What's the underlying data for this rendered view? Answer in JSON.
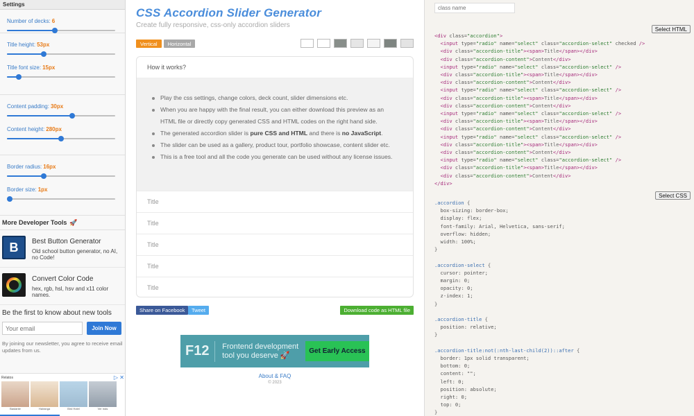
{
  "sidebar": {
    "header": "Settings",
    "controls": [
      {
        "label": "Number of decks:",
        "value": "6",
        "pct": 0.44
      },
      {
        "label": "Title height:",
        "value": "53px",
        "pct": 0.34
      },
      {
        "label": "Title font size:",
        "value": "15px",
        "pct": 0.11
      },
      {
        "label": "Content padding:",
        "value": "30px",
        "pct": 0.6
      },
      {
        "label": "Content height:",
        "value": "280px",
        "pct": 0.5
      },
      {
        "label": "Border radius:",
        "value": "16px",
        "pct": 0.34
      },
      {
        "label": "Border size:",
        "value": "1px",
        "pct": 0.0
      }
    ],
    "more_tools_title": "More Developer Tools",
    "tools": [
      {
        "name": "Best Button Generator",
        "desc": "Old school button generator, no AI, no Code!",
        "logo": "B"
      },
      {
        "name": "Convert Color Code",
        "desc": "hex, rgb, hsl, hsv and x11 color names.",
        "logo": "C"
      }
    ],
    "newsletter": {
      "title": "Be the first to know about new tools",
      "placeholder": "Your email",
      "button": "Join Now",
      "note": "By joining our newsletter, you agree to receive email updates from us."
    },
    "ad": {
      "label": "Relatos",
      "captions": [
        "Bastante",
        "Hairanga",
        "Bird Hotel",
        "Ver más"
      ]
    }
  },
  "main": {
    "title": "CSS Accordion Slider Generator",
    "subtitle": "Create fully responsive, css-only accordion sliders",
    "orientation": {
      "vertical": "Vertical",
      "horizontal": "Horizontal"
    },
    "swatches": [
      "#ffffff",
      "#ffffff",
      "#888e8a",
      "#e6e6e6",
      "#f4f4f4",
      "#7e8581",
      "#e4e4e4"
    ],
    "accordion": {
      "open_title": "How it works?",
      "bullets": [
        {
          "pre": "Play the css settings, change colors, deck count, slider dimensions etc.",
          "bold": "",
          "post": "",
          "bold2": "",
          "post2": ""
        },
        {
          "pre": "When you are happy with the final result, you can either download this preview as an HTML file or directly copy generated CSS and HTML codes on the right hand side.",
          "bold": "",
          "post": "",
          "bold2": "",
          "post2": ""
        },
        {
          "pre": "The generated accordion slider is ",
          "bold": "pure CSS and HTML",
          "post": " and there is ",
          "bold2": "no JavaScript",
          "post2": "."
        },
        {
          "pre": "The slider can be used as a gallery, product tour, portfolio showcase, content slider etc.",
          "bold": "",
          "post": "",
          "bold2": "",
          "post2": ""
        },
        {
          "pre": "This is a free tool and all the code you generate can be used without any license issues.",
          "bold": "",
          "post": "",
          "bold2": "",
          "post2": ""
        }
      ],
      "titles": [
        "Title",
        "Title",
        "Title",
        "Title",
        "Title"
      ]
    },
    "share_facebook": "Share on Facebook",
    "tweet": "Tweet",
    "download": "Download code as HTML file",
    "banner": {
      "logo": "F12",
      "text": "Frontend development tool you deserve 🚀",
      "button": "Get Early Access"
    },
    "footer_link": "About & FAQ",
    "footer_copy": "© 2023"
  },
  "code_panel": {
    "class_placeholder": "class name",
    "select_html": "Select HTML",
    "select_css": "Select CSS"
  },
  "colors": {
    "accent": "#2f79d6",
    "orange": "#e77b18",
    "title": "#4a8ddb",
    "facebook": "#3b5998",
    "tweet": "#55acee",
    "download": "#4caf32",
    "vertical_btn": "#f0901e",
    "horizontal_btn": "#a8a8a8"
  }
}
